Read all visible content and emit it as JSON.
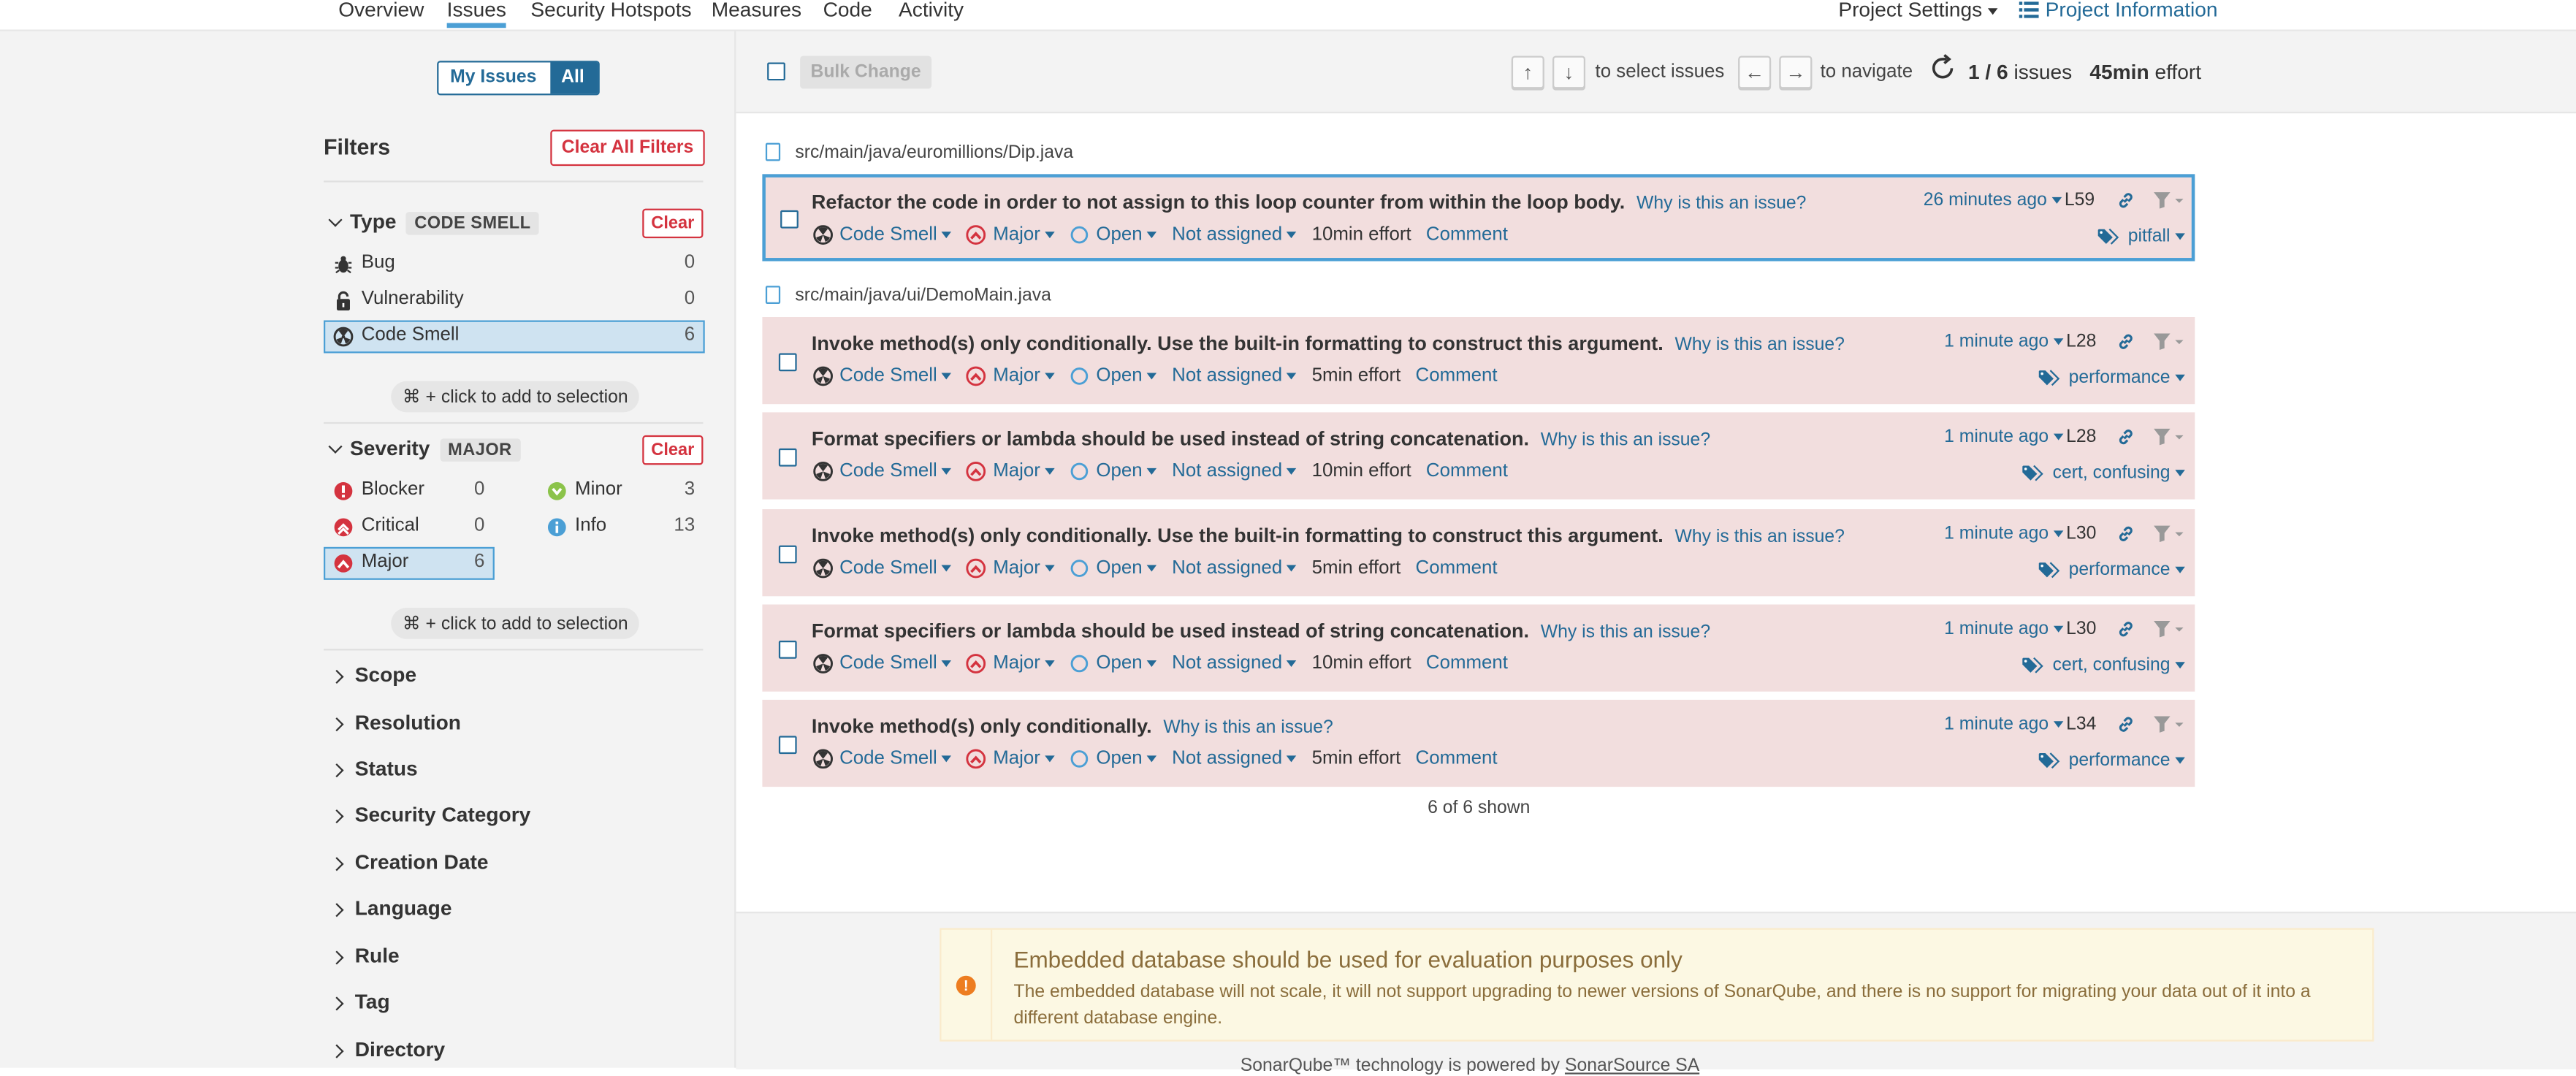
{
  "nav": {
    "tabs": [
      "Overview",
      "Issues",
      "Security Hotspots",
      "Measures",
      "Code",
      "Activity"
    ],
    "project_settings": "Project Settings",
    "project_information": "Project Information"
  },
  "sidebar": {
    "my_issues": "My Issues",
    "all": "All",
    "filters_title": "Filters",
    "clear_all": "Clear All Filters",
    "type": {
      "title": "Type",
      "badge": "CODE SMELL",
      "clear": "Clear",
      "items": [
        {
          "label": "Bug",
          "count": "0"
        },
        {
          "label": "Vulnerability",
          "count": "0"
        },
        {
          "label": "Code Smell",
          "count": "6"
        }
      ]
    },
    "hint": "⌘ + click to add to selection",
    "severity": {
      "title": "Severity",
      "badge": "MAJOR",
      "clear": "Clear",
      "items": [
        {
          "label": "Blocker",
          "count": "0"
        },
        {
          "label": "Minor",
          "count": "3"
        },
        {
          "label": "Critical",
          "count": "0"
        },
        {
          "label": "Info",
          "count": "13"
        },
        {
          "label": "Major",
          "count": "6"
        }
      ]
    },
    "facets": [
      "Scope",
      "Resolution",
      "Status",
      "Security Category",
      "Creation Date",
      "Language",
      "Rule",
      "Tag",
      "Directory"
    ]
  },
  "toolbar": {
    "bulk_change": "Bulk Change",
    "up": "↑",
    "down": "↓",
    "select_text": "to select issues",
    "left": "←",
    "right": "→",
    "navigate_text": "to navigate",
    "count": "1 / 6",
    "issues_word": "issues",
    "effort_value": "45min",
    "effort_word": "effort"
  },
  "files": [
    "src/main/java/euromillions/Dip.java",
    "src/main/java/ui/DemoMain.java"
  ],
  "issues": [
    {
      "message": "Refactor the code in order to not assign to this loop counter from within the loop body.",
      "why": "Why is this an issue?",
      "type": "Code Smell",
      "severity": "Major",
      "status": "Open",
      "assignee": "Not assigned",
      "effort": "10min effort",
      "comment": "Comment",
      "when": "26 minutes ago",
      "line": "L59",
      "tags": "pitfall"
    },
    {
      "message": "Invoke method(s) only conditionally. Use the built-in formatting to construct this argument.",
      "why": "Why is this an issue?",
      "type": "Code Smell",
      "severity": "Major",
      "status": "Open",
      "assignee": "Not assigned",
      "effort": "5min effort",
      "comment": "Comment",
      "when": "1 minute ago",
      "line": "L28",
      "tags": "performance"
    },
    {
      "message": "Format specifiers or lambda should be used instead of string concatenation.",
      "why": "Why is this an issue?",
      "type": "Code Smell",
      "severity": "Major",
      "status": "Open",
      "assignee": "Not assigned",
      "effort": "10min effort",
      "comment": "Comment",
      "when": "1 minute ago",
      "line": "L28",
      "tags": "cert, confusing"
    },
    {
      "message": "Invoke method(s) only conditionally. Use the built-in formatting to construct this argument.",
      "why": "Why is this an issue?",
      "type": "Code Smell",
      "severity": "Major",
      "status": "Open",
      "assignee": "Not assigned",
      "effort": "5min effort",
      "comment": "Comment",
      "when": "1 minute ago",
      "line": "L30",
      "tags": "performance"
    },
    {
      "message": "Format specifiers or lambda should be used instead of string concatenation.",
      "why": "Why is this an issue?",
      "type": "Code Smell",
      "severity": "Major",
      "status": "Open",
      "assignee": "Not assigned",
      "effort": "10min effort",
      "comment": "Comment",
      "when": "1 minute ago",
      "line": "L30",
      "tags": "cert, confusing"
    },
    {
      "message": "Invoke method(s) only conditionally.",
      "why": "Why is this an issue?",
      "type": "Code Smell",
      "severity": "Major",
      "status": "Open",
      "assignee": "Not assigned",
      "effort": "5min effort",
      "comment": "Comment",
      "when": "1 minute ago",
      "line": "L34",
      "tags": "performance"
    }
  ],
  "shown": "6 of 6 shown",
  "alert": {
    "title": "Embedded database should be used for evaluation purposes only",
    "text": "The embedded database will not scale, it will not support upgrading to newer versions of SonarQube, and there is no support for migrating your data out of it into a different database engine."
  },
  "footer": {
    "prefix": "SonarQube™ technology is powered by ",
    "company": "SonarSource SA"
  },
  "colors": {
    "accent": "#236a97",
    "selected_border": "#4b9fd5",
    "issue_bg": "#f2dede",
    "danger": "#d4333f",
    "warning_bg": "#fcf8e3"
  }
}
